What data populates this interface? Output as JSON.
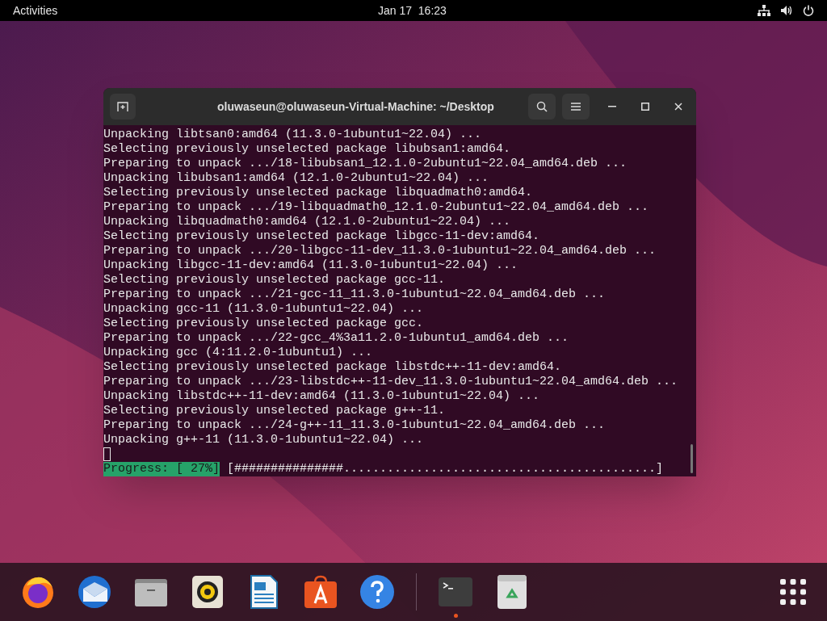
{
  "top_bar": {
    "activities": "Activities",
    "clock": "Jan 17  16:23"
  },
  "terminal": {
    "title": "oluwaseun@oluwaseun-Virtual-Machine: ~/Desktop",
    "lines": [
      "Unpacking libtsan0:amd64 (11.3.0-1ubuntu1~22.04) ...",
      "Selecting previously unselected package libubsan1:amd64.",
      "Preparing to unpack .../18-libubsan1_12.1.0-2ubuntu1~22.04_amd64.deb ...",
      "Unpacking libubsan1:amd64 (12.1.0-2ubuntu1~22.04) ...",
      "Selecting previously unselected package libquadmath0:amd64.",
      "Preparing to unpack .../19-libquadmath0_12.1.0-2ubuntu1~22.04_amd64.deb ...",
      "Unpacking libquadmath0:amd64 (12.1.0-2ubuntu1~22.04) ...",
      "Selecting previously unselected package libgcc-11-dev:amd64.",
      "Preparing to unpack .../20-libgcc-11-dev_11.3.0-1ubuntu1~22.04_amd64.deb ...",
      "Unpacking libgcc-11-dev:amd64 (11.3.0-1ubuntu1~22.04) ...",
      "Selecting previously unselected package gcc-11.",
      "Preparing to unpack .../21-gcc-11_11.3.0-1ubuntu1~22.04_amd64.deb ...",
      "Unpacking gcc-11 (11.3.0-1ubuntu1~22.04) ...",
      "Selecting previously unselected package gcc.",
      "Preparing to unpack .../22-gcc_4%3a11.2.0-1ubuntu1_amd64.deb ...",
      "Unpacking gcc (4:11.2.0-1ubuntu1) ...",
      "Selecting previously unselected package libstdc++-11-dev:amd64.",
      "Preparing to unpack .../23-libstdc++-11-dev_11.3.0-1ubuntu1~22.04_amd64.deb ...",
      "Unpacking libstdc++-11-dev:amd64 (11.3.0-1ubuntu1~22.04) ...",
      "Selecting previously unselected package g++-11.",
      "Preparing to unpack .../24-g++-11_11.3.0-1ubuntu1~22.04_amd64.deb ...",
      "Unpacking g++-11 (11.3.0-1ubuntu1~22.04) ..."
    ],
    "progress": {
      "label": "Progress: [ 27%]",
      "bar": "[###############...........................................]"
    }
  },
  "dock": [
    {
      "kind": "firefox",
      "running": false
    },
    {
      "kind": "mail",
      "running": false
    },
    {
      "kind": "files",
      "running": false
    },
    {
      "kind": "music",
      "running": false
    },
    {
      "kind": "writer",
      "running": false
    },
    {
      "kind": "software",
      "running": false
    },
    {
      "kind": "help",
      "running": false
    },
    {
      "kind": "separator"
    },
    {
      "kind": "terminal",
      "running": true
    },
    {
      "kind": "trash",
      "running": false
    }
  ]
}
